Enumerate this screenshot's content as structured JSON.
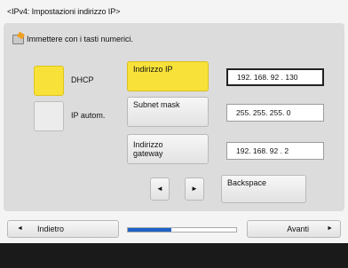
{
  "title": "<IPv4: Impostazioni indirizzo IP>",
  "instruction": "Immettere con i tasti numerici.",
  "modes": [
    {
      "label": "DHCP",
      "selected": true
    },
    {
      "label": "IP autom.",
      "selected": false
    }
  ],
  "fields": [
    {
      "label": "Indirizzo IP",
      "value": "192. 168. 92  . 130",
      "selected": true
    },
    {
      "label": "Subnet mask",
      "value": "255. 255. 255. 0",
      "selected": false
    },
    {
      "label_line1": "Indirizzo",
      "label_line2": "gateway",
      "value": "192. 168. 92  . 2",
      "selected": false
    }
  ],
  "arrows": {
    "left": "◄",
    "right": "►"
  },
  "backspace_label": "Backspace",
  "nav": {
    "back_label": "Indietro",
    "next_label": "Avanti",
    "back_arrow": "◄",
    "next_arrow": "►"
  },
  "progress": 0.4,
  "colors": {
    "accent": "#f8e23a",
    "progress": "#1f63c6"
  }
}
